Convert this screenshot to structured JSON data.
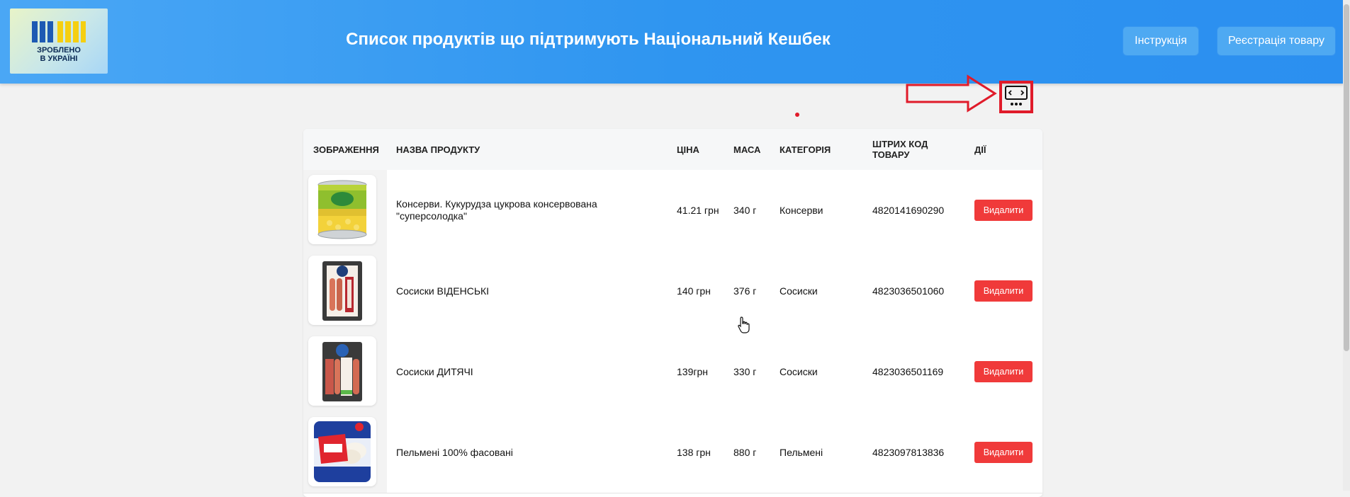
{
  "header": {
    "logo_line1": "ЗРОБЛЕНО",
    "logo_line2": "В УКРАЇНІ",
    "title": "Список продуктів що підтримують Національний Кешбек",
    "instruction_label": "Інструкція",
    "register_label": "Реєстрація товару"
  },
  "colors": {
    "header_blue": "#2f95f0",
    "delete_red": "#f03a3a",
    "annotation_red": "#e01b2a",
    "logo_blue": "#1d5ab3",
    "logo_yellow": "#f5cf10"
  },
  "table": {
    "columns": [
      "ЗОБРАЖЕННЯ",
      "НАЗВА ПРОДУКТУ",
      "ЦІНА",
      "МАСА",
      "КАТЕГОРІЯ",
      "ШТРИХ КОД ТОВАРУ",
      "ДІЇ"
    ],
    "rows": [
      {
        "name": "Консерви. Кукурудза цукрова консервована \"суперсолодка\"",
        "price": "41.21 грн",
        "mass": "340 г",
        "category": "Консерви",
        "barcode": "4820141690290",
        "action": "Видалити",
        "image_icon": "corn-can-icon"
      },
      {
        "name": "Сосиски ВІДЕНСЬКІ",
        "price": "140 грн",
        "mass": "376 г",
        "category": "Сосиски",
        "barcode": "4823036501060",
        "action": "Видалити",
        "image_icon": "sausage-pack-icon"
      },
      {
        "name": "Сосиски ДИТЯЧІ",
        "price": "139грн",
        "mass": "330 г",
        "category": "Сосиски",
        "barcode": "4823036501169",
        "action": "Видалити",
        "image_icon": "sausage-pack-icon"
      },
      {
        "name": "Пельмені 100% фасовані",
        "price": "138 грн",
        "mass": "880 г",
        "category": "Пельмені",
        "barcode": "4823097813836",
        "action": "Видалити",
        "image_icon": "dumplings-pack-icon"
      }
    ]
  },
  "annotation": {
    "icon": "embed-code-icon"
  }
}
